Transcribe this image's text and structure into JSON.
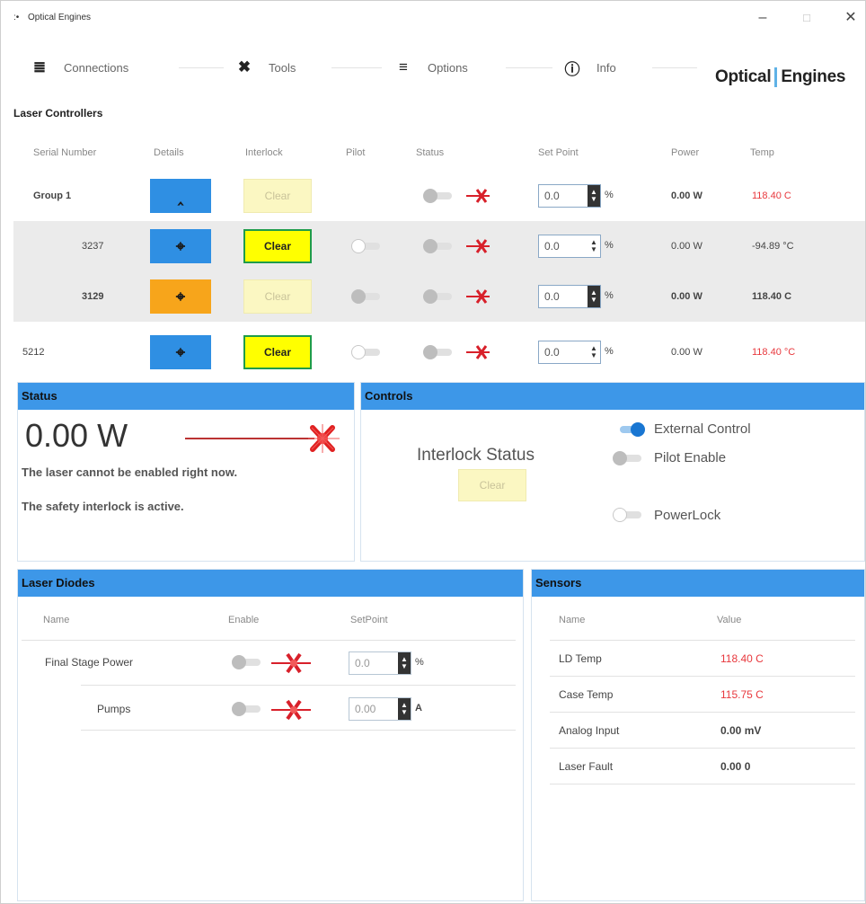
{
  "window": {
    "title": "Optical Engines",
    "app_icon": ":•",
    "minimize": "–",
    "maximize": "□",
    "close": "✕"
  },
  "nav": {
    "items": [
      {
        "label": "Connections",
        "icon": "sliders-icon",
        "glyph": "≣"
      },
      {
        "label": "Tools",
        "icon": "tools-icon",
        "glyph": "✖"
      },
      {
        "label": "Options",
        "icon": "options-icon",
        "glyph": "≡"
      },
      {
        "label": "Info",
        "icon": "info-icon",
        "glyph": "ⓘ"
      }
    ],
    "logo_left": "Optical",
    "logo_right": "Engines"
  },
  "laser_controllers": {
    "title": "Laser Controllers",
    "headers": [
      "Serial Number",
      "Details",
      "Interlock",
      "Pilot",
      "Status",
      "Set Point",
      "Power",
      "Temp"
    ],
    "rows": [
      {
        "serial": "Group 1",
        "details_glyph": "‸",
        "clear": "Clear",
        "clear_enabled": false,
        "pilot": null,
        "setpoint": "0.0",
        "unit": "%",
        "power": "0.00 W",
        "temp": "118.40 C",
        "temp_red": true
      },
      {
        "serial": "3237",
        "details_glyph": "⌖",
        "clear": "Clear",
        "clear_enabled": true,
        "pilot": "off",
        "setpoint": "0.0",
        "unit": "%",
        "power": "0.00 W",
        "temp": "-94.89 °C",
        "temp_red": false
      },
      {
        "serial": "3129",
        "details_glyph": "⌖",
        "clear": "Clear",
        "clear_enabled": false,
        "pilot": "gray",
        "setpoint": "0.0",
        "unit": "%",
        "power": "0.00 W",
        "temp": "118.40 C",
        "temp_red": false
      },
      {
        "serial": "5212",
        "details_glyph": "⌖",
        "clear": "Clear",
        "clear_enabled": true,
        "pilot": "off",
        "setpoint": "0.0",
        "unit": "%",
        "power": "0.00 W",
        "temp": "118.40 °C",
        "temp_red": true
      }
    ]
  },
  "status_panel": {
    "title": "Status",
    "power": "0.00 W",
    "message1": "The laser cannot be enabled right now.",
    "message2": "The safety interlock is active."
  },
  "controls_panel": {
    "title": "Controls",
    "interlock_status": "Interlock Status",
    "clear": "Clear",
    "external_control": "External Control",
    "pilot_enable": "Pilot Enable",
    "powerlock": "PowerLock"
  },
  "laser_diodes": {
    "title": "Laser Diodes",
    "headers": [
      "Name",
      "Enable",
      "SetPoint"
    ],
    "rows": [
      {
        "name": "Final Stage Power",
        "setpoint": "0.0",
        "unit": "%"
      },
      {
        "name": "Pumps",
        "setpoint": "0.00",
        "unit": "A"
      }
    ]
  },
  "sensors": {
    "title": "Sensors",
    "headers": [
      "Name",
      "Value"
    ],
    "rows": [
      {
        "name": "LD Temp",
        "value": "118.40 C",
        "red": true
      },
      {
        "name": "Case Temp",
        "value": "115.75 C",
        "red": true
      },
      {
        "name": "Analog Input",
        "value": "0.00 mV",
        "red": false
      },
      {
        "name": "Laser Fault",
        "value": "0.00 0",
        "red": false
      }
    ]
  },
  "colors": {
    "panel_header": "#3d97e8",
    "details_blue": "#2f8fe3",
    "details_orange": "#f7a51b",
    "clear_yellow": "#ffff00",
    "alert_red": "#e8383d"
  }
}
